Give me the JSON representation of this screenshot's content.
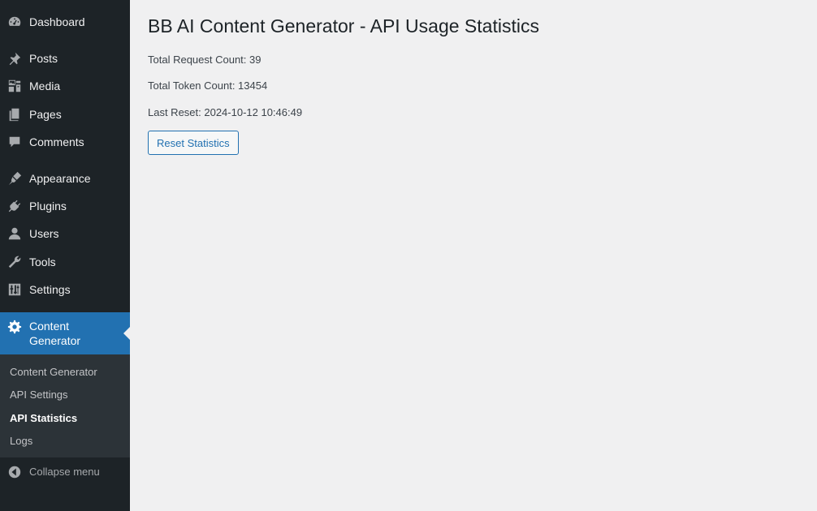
{
  "sidebar": {
    "items": [
      {
        "label": "Dashboard",
        "icon": "dashboard-icon"
      },
      {
        "label": "Posts",
        "icon": "pushpin-icon"
      },
      {
        "label": "Media",
        "icon": "media-icon"
      },
      {
        "label": "Pages",
        "icon": "pages-icon"
      },
      {
        "label": "Comments",
        "icon": "comments-icon"
      },
      {
        "label": "Appearance",
        "icon": "paintbrush-icon"
      },
      {
        "label": "Plugins",
        "icon": "plugins-icon"
      },
      {
        "label": "Users",
        "icon": "users-icon"
      },
      {
        "label": "Tools",
        "icon": "wrench-icon"
      },
      {
        "label": "Settings",
        "icon": "settings-sliders-icon"
      },
      {
        "label": "Content Generator",
        "icon": "gear-icon",
        "current": true
      }
    ],
    "submenu": [
      {
        "label": "Content Generator"
      },
      {
        "label": "API Settings"
      },
      {
        "label": "API Statistics",
        "active": true
      },
      {
        "label": "Logs"
      }
    ],
    "collapse_label": "Collapse menu"
  },
  "main": {
    "title": "BB AI Content Generator - API Usage Statistics",
    "stats": {
      "total_request": "Total Request Count: 39",
      "total_token": "Total Token Count: 13454",
      "last_reset": "Last Reset: 2024-10-12 10:46:49"
    },
    "reset_button_label": "Reset Statistics"
  },
  "colors": {
    "sidebar_bg": "#1d2327",
    "submenu_bg": "#2c3338",
    "accent": "#2271b1",
    "page_bg": "#f0f0f1"
  }
}
